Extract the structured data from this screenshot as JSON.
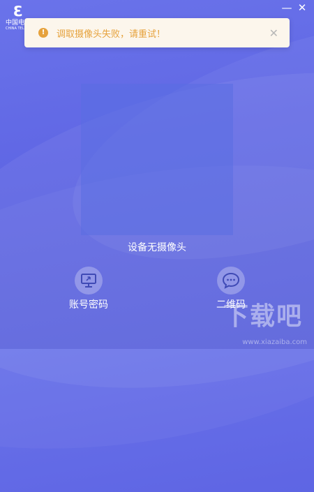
{
  "window": {
    "minimize_icon": "minimize-icon",
    "close_icon": "close-icon"
  },
  "logo": {
    "brand_cn": "中国电信",
    "brand_en": "CHINA TELECOM"
  },
  "toast": {
    "type": "warning",
    "message": "调取摄像头失败，请重试！",
    "accent_color": "#e6a23c"
  },
  "camera": {
    "status": "设备无摄像头"
  },
  "login_options": {
    "account": {
      "label": "账号密码",
      "icon": "monitor-icon"
    },
    "qr": {
      "label": "二维码",
      "icon": "chat-bubble-icon"
    }
  },
  "watermark": {
    "text": "下载吧",
    "url": "www.xiazaiba.com"
  }
}
